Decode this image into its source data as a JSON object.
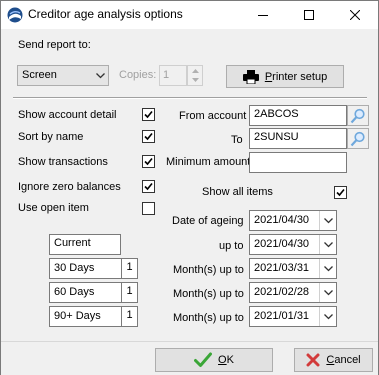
{
  "window": {
    "title": "Creditor age analysis options"
  },
  "send_report": {
    "label": "Send report to:",
    "destination": "Screen",
    "copies_label": "Copies:",
    "copies_value": "1",
    "printer_setup_pre": "",
    "printer_setup_ul": "P",
    "printer_setup_post": "rinter setup"
  },
  "options": {
    "show_account_detail": {
      "label": "Show account detail",
      "checked": true
    },
    "sort_by_name": {
      "label": "Sort by name",
      "checked": true
    },
    "show_transactions": {
      "label": "Show transactions",
      "checked": true
    },
    "ignore_zero_balances": {
      "label": "Ignore zero balances",
      "checked": true
    },
    "use_open_item": {
      "label": "Use open item",
      "checked": false
    }
  },
  "filters": {
    "from_account_label": "From account",
    "from_account_value": "2ABCOS",
    "to_label": "To",
    "to_value": "2SUNSU",
    "minimum_amount_label": "Minimum amount",
    "minimum_amount_value": "",
    "show_all_items_label": "Show all items",
    "show_all_items_checked": true
  },
  "ageing": {
    "date_of_ageing_label": "Date of ageing",
    "date_of_ageing_value": "2021/04/30",
    "periods": [
      {
        "name": "Current",
        "label": "up to",
        "date": "2021/04/30"
      },
      {
        "name": "30 Days",
        "months": "1",
        "label": "Month(s) up to",
        "date": "2021/03/31"
      },
      {
        "name": "60 Days",
        "months": "1",
        "label": "Month(s) up to",
        "date": "2021/02/28"
      },
      {
        "name": "90+ Days",
        "months": "1",
        "label": "Month(s) up to",
        "date": "2021/01/31"
      }
    ]
  },
  "buttons": {
    "ok_ul": "O",
    "ok_post": "K",
    "cancel_ul": "C",
    "cancel_post": "ancel"
  },
  "colors": {
    "ok_check": "#3aa637",
    "cancel_x": "#d23b3b",
    "search_icon": "#6fa8dc"
  }
}
